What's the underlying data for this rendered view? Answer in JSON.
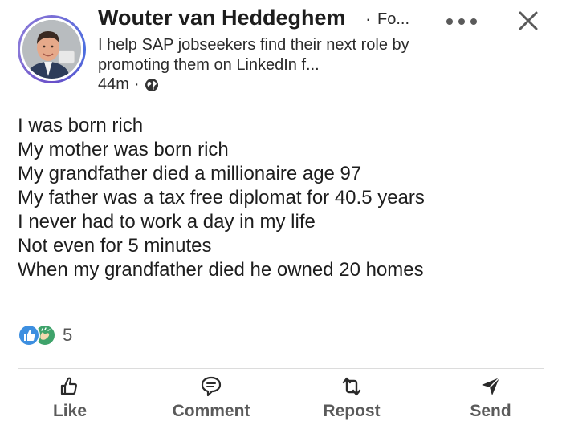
{
  "post": {
    "author": {
      "name": "Wouter van Heddeghem",
      "follow_label": "Fo...",
      "headline": "I help SAP jobseekers find their next role by promoting them on LinkedIn f...",
      "time": "44m",
      "visibility_icon": "globe-icon"
    },
    "body_lines": [
      "I was born rich",
      "My mother was born rich",
      "My grandfather died a millionaire age 97",
      "My father was a tax free diplomat for 40.5 years",
      "I never had to work a day in my life",
      "Not even for 5 minutes",
      "When my grandfather died he owned 20 homes"
    ],
    "reactions": {
      "count": "5",
      "types": [
        "like-reaction-icon",
        "celebrate-reaction-icon"
      ]
    },
    "actions": {
      "like": "Like",
      "comment": "Comment",
      "repost": "Repost",
      "send": "Send"
    }
  },
  "colors": {
    "text": "#1d1d1d",
    "secondary_text": "#5a5a5a",
    "like_reaction": "#3d8fe0",
    "celebrate_reaction": "#3fa36b",
    "avatar_ring": "#6a4fc8"
  }
}
